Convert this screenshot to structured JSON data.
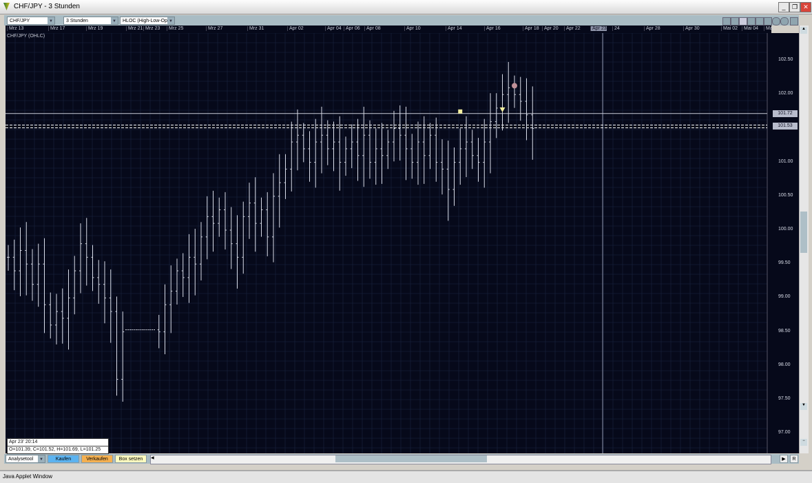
{
  "window": {
    "title": "CHF/JPY - 3 Stunden",
    "minimize": "_",
    "restore": "❐",
    "close": "✕"
  },
  "toolbar": {
    "symbol": "CHF/JPY",
    "interval": "3 Stunden",
    "chart_type": "HLOC (High-Low-Op"
  },
  "bottom": {
    "analysis": "Analysetool",
    "buy": "Kaufen",
    "sell": "Verkaufen",
    "box": "Box setzen",
    "r_button": "R"
  },
  "info": {
    "date": "Apr 23' 20:14",
    "values": "O=101.39, C=101.52, H=101.69, L=101.25"
  },
  "status": "Java Applet Window",
  "colors": {
    "bg": "#06091a",
    "bar": "#d8dce8",
    "grid": "#1a2540",
    "buy": "#5cb3f0",
    "sell": "#f5b050",
    "box": "#fffcc0"
  },
  "chart_data": {
    "type": "ohlc",
    "title": "CHF/JPY (OHLC)",
    "x_ticks": [
      "Mrz 13",
      "Mrz 17",
      "Mrz 19",
      "Mrz 21",
      "Mrz 23",
      "Mrz 25",
      "Mrz 27",
      "Mrz 31",
      "Apr 02",
      "Apr 04",
      "Apr 06",
      "Apr 08",
      "Apr 10",
      "Apr 14",
      "Apr 16",
      "Apr 18",
      "Apr 20",
      "Apr 22",
      "Apr 23",
      "24",
      "Apr 28",
      "Apr 30",
      "Mai 02",
      "Mai 04",
      "Ma"
    ],
    "highlight_tick": "Apr 23",
    "y_ticks": [
      "102.50",
      "102.00",
      "101.50",
      "101.00",
      "100.50",
      "100.00",
      "99.50",
      "99.00",
      "98.50",
      "98.00",
      "97.50",
      "97.00"
    ],
    "ylim": [
      96.85,
      102.78
    ],
    "price_lines": [
      {
        "value": "101.72",
        "style": "solid"
      },
      {
        "value": "101.53",
        "style": "dashed"
      }
    ],
    "close": [
      99.6,
      99.4,
      99.7,
      99.5,
      99.2,
      99.5,
      98.9,
      98.6,
      98.8,
      98.7,
      99.0,
      99.4,
      99.8,
      99.6,
      99.3,
      99.2,
      99.0,
      98.8,
      97.8,
      98.5,
      98.53,
      98.53,
      98.53,
      98.53,
      98.53,
      98.5,
      98.9,
      99.1,
      99.4,
      99.3,
      99.6,
      99.5,
      99.9,
      100.2,
      100.1,
      100.3,
      100.0,
      99.8,
      99.6,
      100.2,
      100.4,
      100.1,
      100.3,
      99.9,
      100.5,
      100.7,
      100.9,
      101.3,
      101.4,
      101.2,
      101.0,
      101.3,
      101.4,
      101.2,
      101.3,
      101.0,
      101.2,
      101.3,
      101.1,
      101.4,
      101.0,
      101.2,
      101.1,
      101.3,
      101.5,
      101.4,
      101.2,
      101.0,
      101.3,
      101.1,
      101.4,
      101.0,
      100.9,
      100.6,
      101.0,
      101.2,
      101.3,
      101.1,
      101.0,
      101.3,
      101.6,
      101.8,
      102.0,
      102.1,
      102.0,
      101.9,
      101.7,
      101.5
    ],
    "markers": [
      {
        "type": "square",
        "value": 101.75,
        "bar": 75
      },
      {
        "type": "triangle",
        "value": 101.78,
        "bar": 82
      },
      {
        "type": "circle",
        "value": 102.13,
        "bar": 84
      }
    ]
  }
}
